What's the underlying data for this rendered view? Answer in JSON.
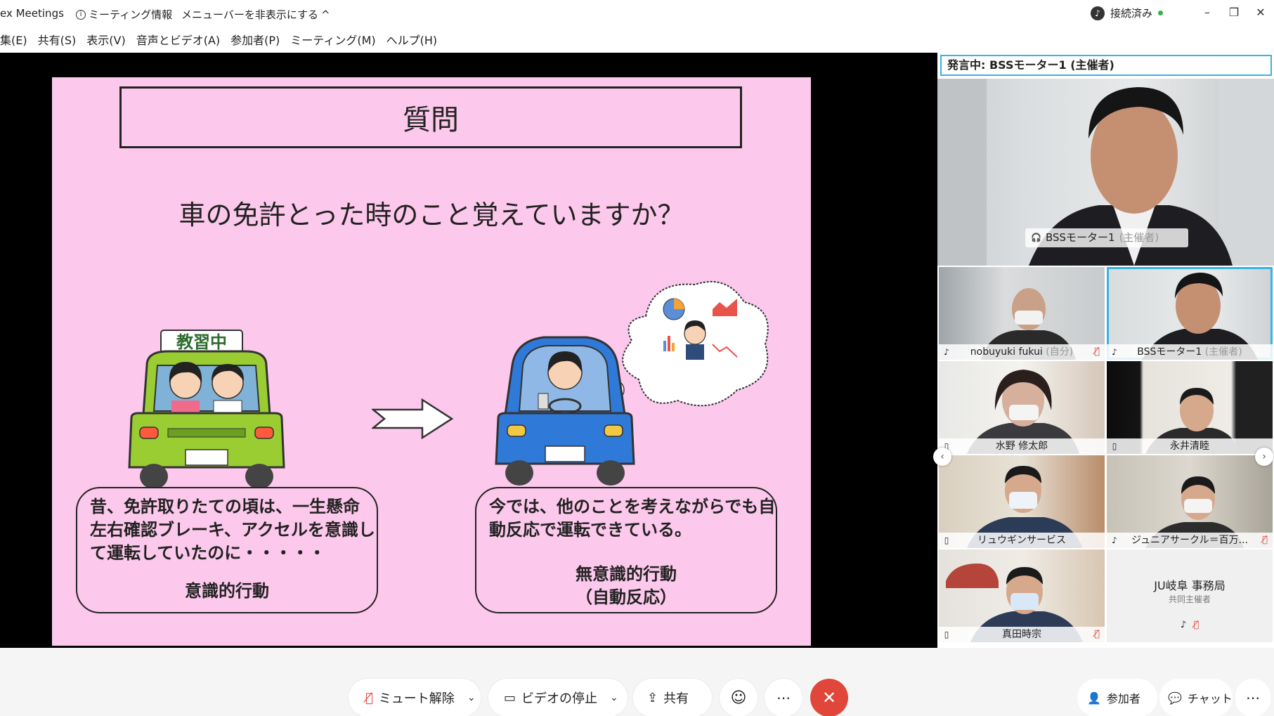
{
  "window": {
    "app_title": "ex Meetings",
    "meeting_info": "ミーティング情報",
    "hide_menu": "メニューバーを非表示にする",
    "connection_status": "接続済み"
  },
  "menu": [
    "集(E)",
    "共有(S)",
    "表示(V)",
    "音声とビデオ(A)",
    "参加者(P)",
    "ミーティング(M)",
    "ヘルプ(H)"
  ],
  "slide": {
    "title": "質問",
    "question": "車の免許とった時のこと覚えていますか？",
    "sign_text": "教習中",
    "left_bubble": {
      "lines": [
        "昔、免許取りたての頃は、一生懸命",
        "左右確認ブレーキ、アクセルを意識し",
        "て運転していたのに・・・・・"
      ],
      "label": "意識的行動"
    },
    "right_bubble": {
      "lines": [
        "今では、他のことを考えながらでも自",
        "動反応で運転できている。"
      ],
      "label_lines": [
        "無意識的行動",
        "（自動反応）"
      ]
    }
  },
  "panel": {
    "speaking_prefix": "発言中: ",
    "speaking_name": "BSSモーター1 (主催者)",
    "main_video_name": "BSSモーター1",
    "main_video_role": "(主催者)",
    "participants": [
      {
        "name": "nobuyuki fukui",
        "tag": "(自分)",
        "mic_muted": true,
        "active": false
      },
      {
        "name": "BSSモーター1",
        "tag": "(主催者)",
        "mic_muted": false,
        "active": true
      },
      {
        "name": "水野 修太郎",
        "tag": "",
        "mic_muted": false,
        "active": false
      },
      {
        "name": "永井清睦",
        "tag": "",
        "mic_muted": false,
        "active": false
      },
      {
        "name": "リュウギンサービス",
        "tag": "",
        "mic_muted": false,
        "active": false
      },
      {
        "name": "ジュニアサークル＝百万...",
        "tag": "",
        "mic_muted": true,
        "active": false
      },
      {
        "name": "真田時宗",
        "tag": "",
        "mic_muted": true,
        "active": false
      }
    ],
    "audio_only": {
      "name": "JU岐阜  事務局",
      "role": "共同主催者"
    }
  },
  "controls": {
    "unmute": "ミュート解除",
    "stop_video": "ビデオの停止",
    "share": "共有",
    "participants": "参加者",
    "chat": "チャット"
  },
  "colors": {
    "accent": "#37b4e0",
    "end_call": "#e0473a",
    "slide_bg": "#fcc8ec",
    "connected": "#2fb34a"
  }
}
